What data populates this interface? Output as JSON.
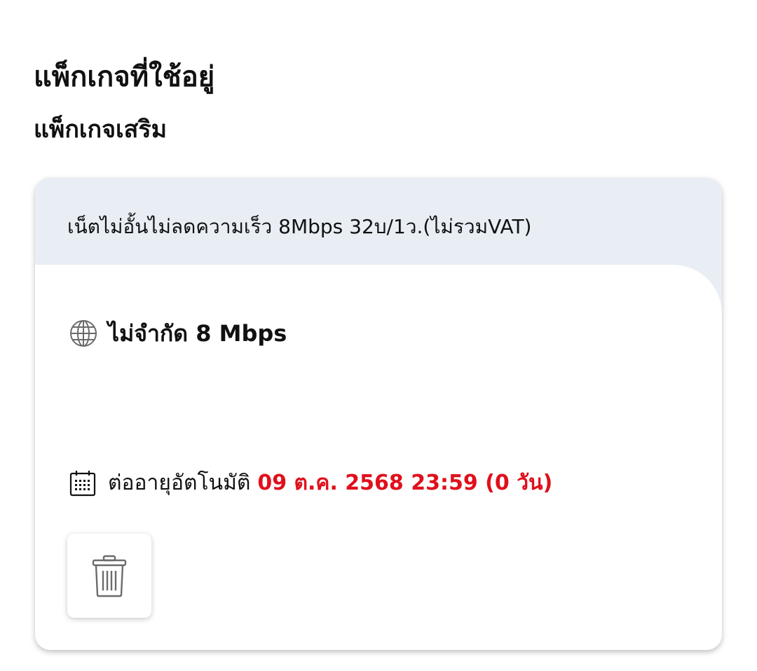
{
  "header": {
    "title": "แพ็กเกจที่ใช้อยู่",
    "section_title": "แพ็กเกจเสริม"
  },
  "package_card": {
    "name": "เน็ตไม่อั้นไม่ลดความเร็ว 8Mbps 32บ/1ว.(ไม่รวมVAT)",
    "feature": {
      "icon": "globe-icon",
      "text": "ไม่จำกัด 8 Mbps"
    },
    "renewal": {
      "icon": "calendar-icon",
      "label": "ต่ออายุอัตโนมัติ",
      "date": "09 ต.ค. 2568 23:59 (0 วัน)"
    },
    "delete_button": {
      "icon": "trash-icon"
    }
  },
  "colors": {
    "card_header_bg": "#e8eef4",
    "renewal_date": "#e0101c",
    "icon_gray": "#6b6b6b"
  }
}
